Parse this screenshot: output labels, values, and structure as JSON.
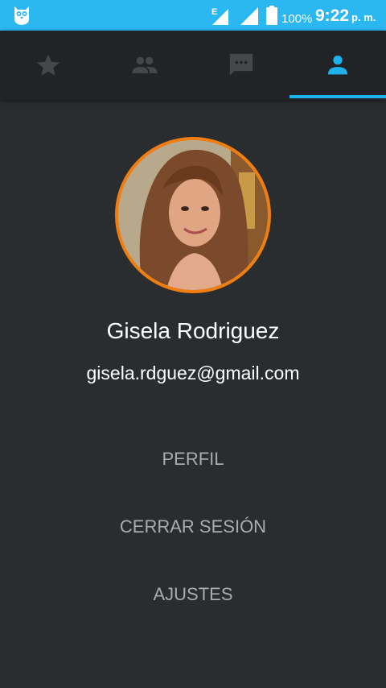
{
  "status_bar": {
    "battery": "100%",
    "time": "9:22",
    "ampm": "p. m.",
    "network_type": "E",
    "app_icon": "owl-icon",
    "background_color": "#2bb7f0"
  },
  "tabs": [
    {
      "icon": "star-icon",
      "active": false
    },
    {
      "icon": "people-icon",
      "active": false
    },
    {
      "icon": "chat-icon",
      "active": false
    },
    {
      "icon": "person-icon",
      "active": true
    }
  ],
  "colors": {
    "accent": "#1fb0ec",
    "avatar_border": "#f07d10",
    "background": "#2a2d30",
    "inactive_icon": "#45484b"
  },
  "profile": {
    "name": "Gisela Rodriguez",
    "email": "gisela.rdguez@gmail.com"
  },
  "menu": {
    "profile_label": "PERFIL",
    "logout_label": "CERRAR SESIÓN",
    "settings_label": "AJUSTES"
  }
}
